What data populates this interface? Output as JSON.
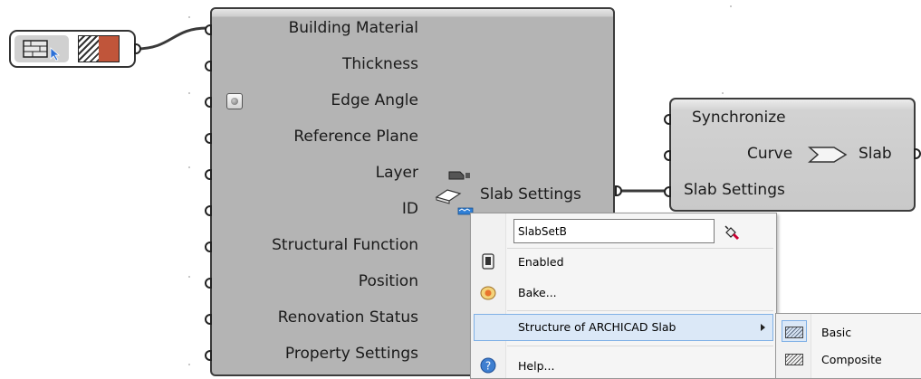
{
  "value_list": {
    "icon": "building-material-list-icon",
    "swatch_colors": {
      "hatch": "#333333",
      "fill": "#c0553a"
    }
  },
  "component": {
    "inputs": [
      "Building Material",
      "Thickness",
      "Edge Angle",
      "Reference Plane",
      "Layer",
      "ID",
      "Structural Function",
      "Position",
      "Renovation Status",
      "Property Settings"
    ],
    "output": "Slab Settings",
    "icon": "slab-settings-icon"
  },
  "slab_component": {
    "inputs": [
      "Synchronize",
      "Curve",
      "Slab Settings"
    ],
    "output": "Slab",
    "icon": "slab-arrow-icon"
  },
  "context_menu": {
    "name_value": "SlabSetB",
    "items": {
      "enabled": "Enabled",
      "bake": "Bake...",
      "structure": "Structure of ARCHICAD Slab",
      "help": "Help..."
    }
  },
  "submenu": {
    "items": [
      "Basic",
      "Composite"
    ],
    "selected": "Basic"
  }
}
